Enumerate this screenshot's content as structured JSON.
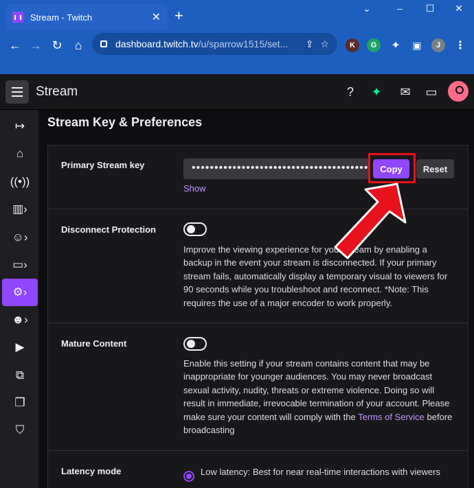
{
  "browser": {
    "tab_title": "Stream - Twitch",
    "url_domain": "dashboard.twitch.tv",
    "url_path": "/u/sparrow1515/set...",
    "window_controls": [
      "–",
      "☐",
      "✕"
    ],
    "profile_initial": "J",
    "ext_k": "K",
    "ext_g": "G"
  },
  "app": {
    "title": "Stream"
  },
  "page": {
    "heading": "Stream Key & Preferences"
  },
  "primary_key": {
    "label": "Primary Stream key",
    "masked_value": "••••••••••••••••••••••••••••••••••••••••",
    "copy_label": "Copy",
    "reset_label": "Reset",
    "show_label": "Show"
  },
  "disconnect": {
    "label": "Disconnect Protection",
    "enabled": false,
    "description": "Improve the viewing experience for your stream by enabling a backup in the event your stream is disconnected. If your primary stream fails, automatically display a temporary visual to viewers for 90 seconds while you troubleshoot and reconnect. *Note: This requires the use of a major encoder to work properly."
  },
  "mature": {
    "label": "Mature Content",
    "enabled": false,
    "description": "Enable this setting if your stream contains content that may be inappropriate for younger audiences. You may never broadcast sexual activity, nudity, threats or extreme violence. Doing so will result in immediate, irrevocable termination of your account. Please make sure your content will comply with the ",
    "terms_link": "Terms of Service",
    "description_end": " before broadcasting"
  },
  "latency": {
    "label": "Latency mode",
    "option_low": "Low latency: Best for near real-time interactions with viewers"
  },
  "colors": {
    "accent": "#9146ff",
    "highlight_box": "#e8121c",
    "browser_bar": "#1c5fbf"
  }
}
